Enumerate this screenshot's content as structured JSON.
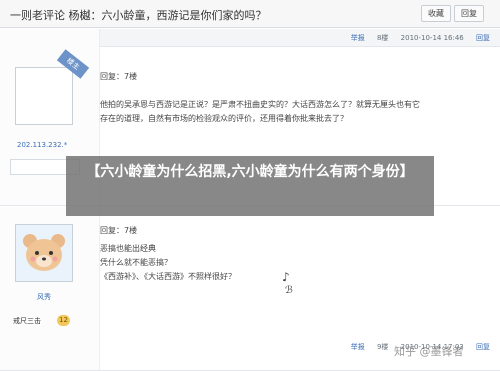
{
  "header": {
    "title": "一则老评论 杨樾：六小龄童，西游记是你们家的吗？",
    "fav_label": "收藏",
    "copy_label": "回复"
  },
  "posts": [
    {
      "report": "举报",
      "floor": "8楼",
      "time": "2010-10-14 16:46",
      "reply_label": "回复",
      "corner_tag": "楼主",
      "ip": "202.113.232.*",
      "reply_to": "回复：7楼",
      "lines": [
        "他拍的吴承恩与西游记是正说？是严肃不扭曲史实的？大话西游怎么了？就算无厘头也有它",
        "存在的道理，自然有市场的检验观众的评价，还用得着你批来批去了？"
      ]
    },
    {
      "report": "举报",
      "floor": "9楼",
      "time": "2010-10-14 17:03",
      "reply_label": "回复",
      "user_name": "风秀",
      "rank_label": "戒尺三击",
      "rank_level": "12",
      "reply_to": "回复：7楼",
      "lines": [
        "恶搞也能出经典",
        "凭什么就不能恶搞？",
        "",
        "《西游补》、《大话西游》不照样很好？"
      ],
      "scribble": "♪",
      "scribble2": "ℬ"
    }
  ],
  "overlay": {
    "text": "【六小龄童为什么招黑,六小龄童为什么有两个身份】"
  },
  "watermark": "知乎 @墨锋者"
}
